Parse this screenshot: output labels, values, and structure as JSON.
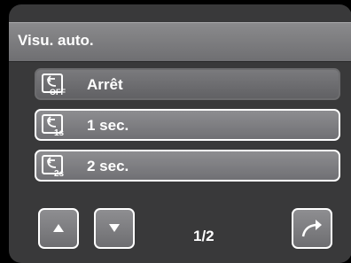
{
  "menu": {
    "title": "Visu. auto.",
    "options": [
      {
        "label": "Arrêt",
        "icon": "review-off-icon",
        "badge": "OFF",
        "selected": true
      },
      {
        "label": "1 sec.",
        "icon": "review-1s-icon",
        "badge": "1s",
        "selected": false
      },
      {
        "label": "2 sec.",
        "icon": "review-2s-icon",
        "badge": "2s",
        "selected": false
      }
    ]
  },
  "footer": {
    "page_indicator": "1/2",
    "up_icon": "arrow-up-icon",
    "down_icon": "arrow-down-icon",
    "back_icon": "return-arrow-icon"
  }
}
